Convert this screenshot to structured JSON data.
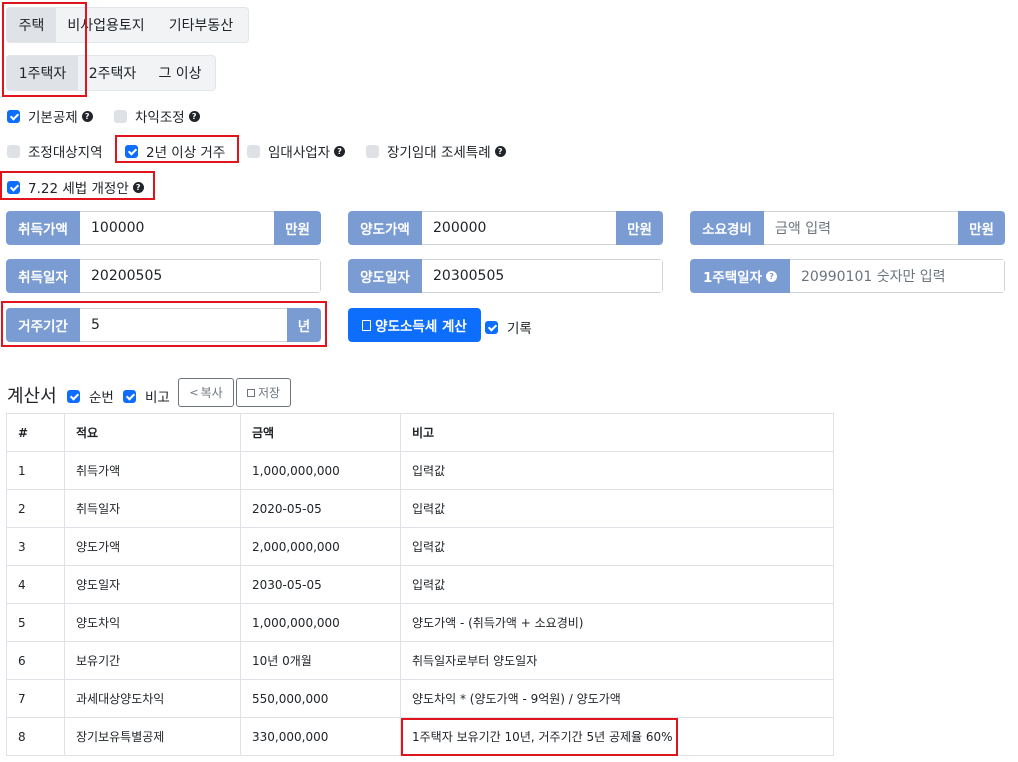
{
  "tabs_type": [
    "주택",
    "비사업용토지",
    "기타부동산"
  ],
  "tabs_count": [
    "1주택자",
    "2주택자",
    "그 이상"
  ],
  "options": {
    "basic_deduction": "기본공제",
    "gain_adjust": "차익조정",
    "regulated_area": "조정대상지역",
    "residence_2y": "2년 이상 거주",
    "rental_business": "임대사업자",
    "long_rental": "장기임대 조세특례",
    "reform_722": "7.22 세법 개정안"
  },
  "fields": {
    "acq_price": {
      "label": "취득가액",
      "value": "100000",
      "unit": "만원"
    },
    "sale_price": {
      "label": "양도가액",
      "value": "200000",
      "unit": "만원"
    },
    "expense": {
      "label": "소요경비",
      "placeholder": "금액 입력",
      "unit": "만원"
    },
    "acq_date": {
      "label": "취득일자",
      "value": "20200505"
    },
    "sale_date": {
      "label": "양도일자",
      "value": "20300505"
    },
    "one_house_date": {
      "label": "1주택일자",
      "placeholder": "20990101 숫자만 입력"
    },
    "residence": {
      "label": "거주기간",
      "value": "5",
      "unit": "년"
    }
  },
  "calc_button": "양도소득세 계산",
  "record_label": "기록",
  "statement": {
    "title": "계산서",
    "seq_label": "순번",
    "note_label": "비고",
    "copy_label": "복사",
    "save_label": "저장"
  },
  "table": {
    "headers": [
      "#",
      "적요",
      "금액",
      "비고"
    ],
    "rows": [
      [
        "1",
        "취득가액",
        "1,000,000,000",
        "입력값"
      ],
      [
        "2",
        "취득일자",
        "2020-05-05",
        "입력값"
      ],
      [
        "3",
        "양도가액",
        "2,000,000,000",
        "입력값"
      ],
      [
        "4",
        "양도일자",
        "2030-05-05",
        "입력값"
      ],
      [
        "5",
        "양도차익",
        "1,000,000,000",
        "양도가액 - (취득가액 + 소요경비)"
      ],
      [
        "6",
        "보유기간",
        "10년 0개월",
        "취득일자로부터 양도일자"
      ],
      [
        "7",
        "과세대상양도차익",
        "550,000,000",
        "양도차익 * (양도가액 - 9억원) / 양도가액"
      ],
      [
        "8",
        "장기보유특별공제",
        "330,000,000",
        "1주택자 보유기간 10년, 거주기간 5년 공제율 60%"
      ]
    ]
  },
  "colors": {
    "label_bg": "#7a9cd3",
    "primary": "#0d6efd",
    "highlight": "#e0141d"
  }
}
